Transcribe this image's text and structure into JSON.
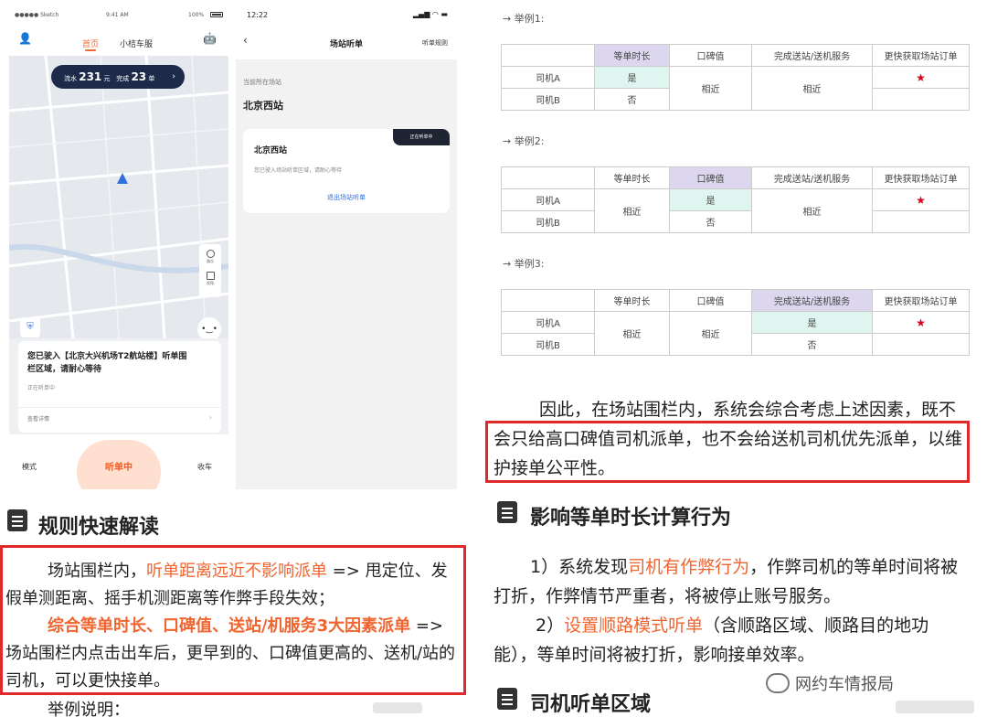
{
  "phone1": {
    "status": {
      "carrier": "●●●●● Sketch",
      "time": "9:41 AM",
      "battery": "100%"
    },
    "tabs": {
      "active": "首页",
      "other": "小桔车服"
    },
    "pill": {
      "label1": "流水",
      "value1": "231",
      "unit1": "元",
      "label2": "完成",
      "value2": "23",
      "unit2": "单"
    },
    "card_title": "您已驶入【北京大兴机场T2航站楼】听单围栏区域，请耐心等待",
    "card_status": "正在听单中",
    "card_more": "查看详情",
    "bottom_left": "模式",
    "bottom_center": "听单中",
    "bottom_right": "收车",
    "ctrl_label1": "路况",
    "ctrl_label2": "视角"
  },
  "phone2": {
    "time": "12:22",
    "title": "场站听单",
    "rules": "听单规则",
    "loc_label": "当前所在场站",
    "loc_name": "北京西站",
    "card_name": "北京西站",
    "badge": "正在听单中",
    "desc": "您已驶入场站听单区域，请耐心等待",
    "exit": "退出场站听单"
  },
  "left": {
    "heading": "规则快速解读",
    "p1_a": "场站围栏内，",
    "p1_b": "听单距离远近不影响派单",
    "p1_c": " => 甩定位、发假单测距离、摇手机测距离等作弊手段失效；",
    "p2_a": "综合等单时长、口碑值、送站/机服务3大因素派单",
    "p2_b": " => 场站围栏内点击出车后，更早到的、口碑值更高的、送机/站的司机，可以更快接单。",
    "footer": "举例说明："
  },
  "tables": {
    "headers": [
      "",
      "等单时长",
      "口碑值",
      "完成送站/送机服务",
      "更快获取场站订单"
    ],
    "driverA": "司机A",
    "driverB": "司机B",
    "yes": "是",
    "no": "否",
    "similar": "相近",
    "star": "★",
    "example1": "→  举例1:",
    "example2": "→  举例2:",
    "example3": "→  举例3:"
  },
  "right": {
    "conclusion": "因此，在场站围栏内，系统会综合考虑上述因素，既不会只给高口碑值司机派单，也不会给送机司机优先派单，以维护接单公平性。",
    "heading2": "影响等单时长计算行为",
    "item1_a": "1）系统发现",
    "item1_b": "司机有作弊行为",
    "item1_c": "，作弊司机的等单时间将被打折，作弊情节严重者，将被停止账号服务。",
    "item2_a": "2）",
    "item2_b": "设置顺路模式听单",
    "item2_c": "（含顺路区域、顺路目的地功能），等单时间将被打折，影响接单效率。",
    "heading3": "司机听单区域",
    "watermark": "网约车情报局"
  },
  "colors": {
    "accent_orange": "#f0642f",
    "highlight_box": "#e02a2a",
    "star": "#d9001b",
    "header_highlight": "#dcd7ee",
    "cell_highlight": "#dff5ef"
  }
}
